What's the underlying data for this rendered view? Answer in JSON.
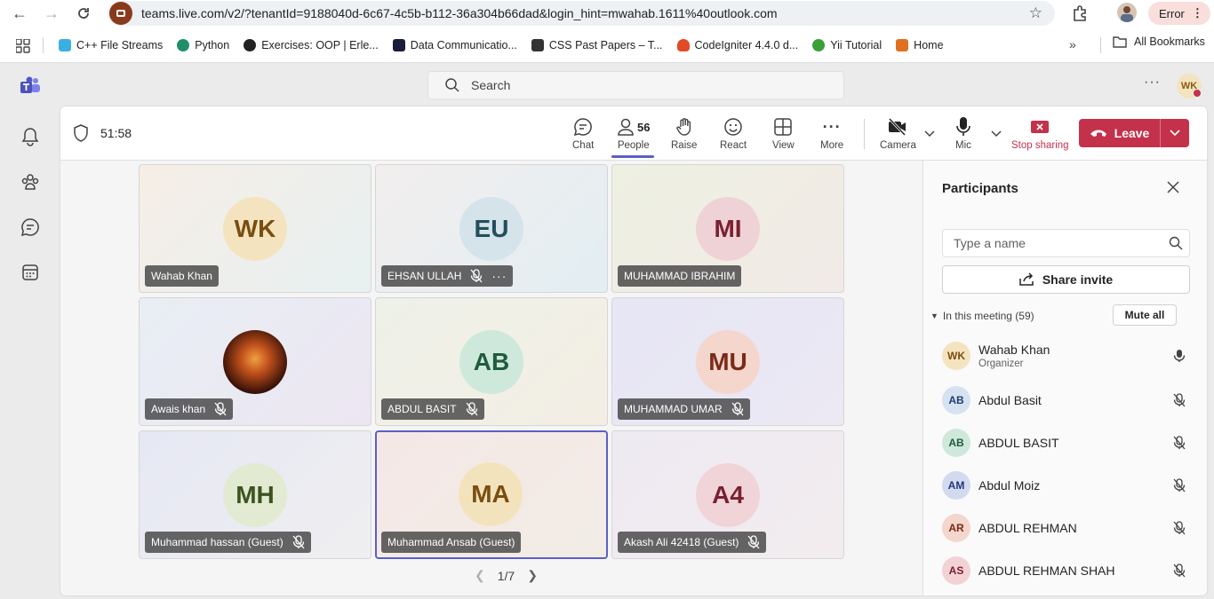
{
  "browser": {
    "url": "teams.live.com/v2/?tenantId=9188040d-6c67-4c5b-b112-36a304b66dad&login_hint=mwahab.1611%40outlook.com",
    "error_label": "Error",
    "bookmarks": [
      {
        "label": "C++ File Streams",
        "color": "#3ab0e0"
      },
      {
        "label": "Python",
        "color": "#1f8f6a"
      },
      {
        "label": "Exercises: OOP | Erle...",
        "color": "#222222"
      },
      {
        "label": "Data Communicatio...",
        "color": "#1b1b3a"
      },
      {
        "label": "CSS Past Papers – T...",
        "color": "#333333"
      },
      {
        "label": "CodeIgniter 4.4.0 d...",
        "color": "#e24a27"
      },
      {
        "label": "Yii Tutorial",
        "color": "#3aa038"
      },
      {
        "label": "Home",
        "color": "#e07020"
      }
    ],
    "all_bookmarks": "All Bookmarks"
  },
  "teams": {
    "search_placeholder": "Search",
    "user_initials": "WK"
  },
  "meeting": {
    "timer": "51:58",
    "toolbar": {
      "chat": "Chat",
      "people": "People",
      "people_count": "56",
      "raise": "Raise",
      "react": "React",
      "view": "View",
      "more": "More",
      "camera": "Camera",
      "mic": "Mic",
      "stop_sharing": "Stop sharing",
      "leave": "Leave"
    },
    "tiles": [
      {
        "initials": "WK",
        "name": "Wahab Khan",
        "muted": false,
        "bg": "#f3e4bf",
        "fg": "#7a4d10"
      },
      {
        "initials": "EU",
        "name": "EHSAN ULLAH",
        "muted": true,
        "bg": "#d4e4ea",
        "fg": "#244e5c"
      },
      {
        "initials": "MI",
        "name": "MUHAMMAD IBRAHIM",
        "muted": false,
        "bg": "#eed2d6",
        "fg": "#7a2030"
      },
      {
        "initials": "",
        "name": "Awais khan",
        "muted": true,
        "bg": "#3a1a10",
        "fg": "#ffffff"
      },
      {
        "initials": "AB",
        "name": "ABDUL BASIT",
        "muted": true,
        "bg": "#cfe8dc",
        "fg": "#1e5c3c"
      },
      {
        "initials": "MU",
        "name": "MUHAMMAD UMAR",
        "muted": true,
        "bg": "#f4d6cc",
        "fg": "#7a2a18"
      },
      {
        "initials": "MH",
        "name": "Muhammad hassan (Guest)",
        "muted": true,
        "bg": "#e2ead2",
        "fg": "#3d5220"
      },
      {
        "initials": "MA",
        "name": "Muhammad Ansab (Guest)",
        "muted": false,
        "bg": "#f3e3bd",
        "fg": "#7a4d10"
      },
      {
        "initials": "A4",
        "name": "Akash Ali 42418 (Guest)",
        "muted": true,
        "bg": "#f1d4d8",
        "fg": "#7a2030"
      }
    ],
    "pager": "1/7"
  },
  "participants": {
    "title": "Participants",
    "search_placeholder": "Type a name",
    "share_invite": "Share invite",
    "section_label": "In this meeting (59)",
    "mute_all": "Mute all",
    "list": [
      {
        "initials": "WK",
        "name": "Wahab Khan",
        "role": "Organizer",
        "muted": false,
        "bg": "#f3e4bf",
        "fg": "#7a4d10"
      },
      {
        "initials": "AB",
        "name": "Abdul Basit",
        "role": "",
        "muted": true,
        "bg": "#d6e2f2",
        "fg": "#1e3f6e"
      },
      {
        "initials": "AB",
        "name": "ABDUL BASIT",
        "role": "",
        "muted": true,
        "bg": "#cfe8dc",
        "fg": "#1e5c3c"
      },
      {
        "initials": "AM",
        "name": "Abdul Moiz",
        "role": "",
        "muted": true,
        "bg": "#d2daf0",
        "fg": "#24367a"
      },
      {
        "initials": "AR",
        "name": "ABDUL REHMAN",
        "role": "",
        "muted": true,
        "bg": "#f4d6cc",
        "fg": "#7a2a18"
      },
      {
        "initials": "AS",
        "name": "ABDUL REHMAN SHAH",
        "role": "",
        "muted": true,
        "bg": "#f3d2d6",
        "fg": "#7a2030"
      }
    ]
  }
}
